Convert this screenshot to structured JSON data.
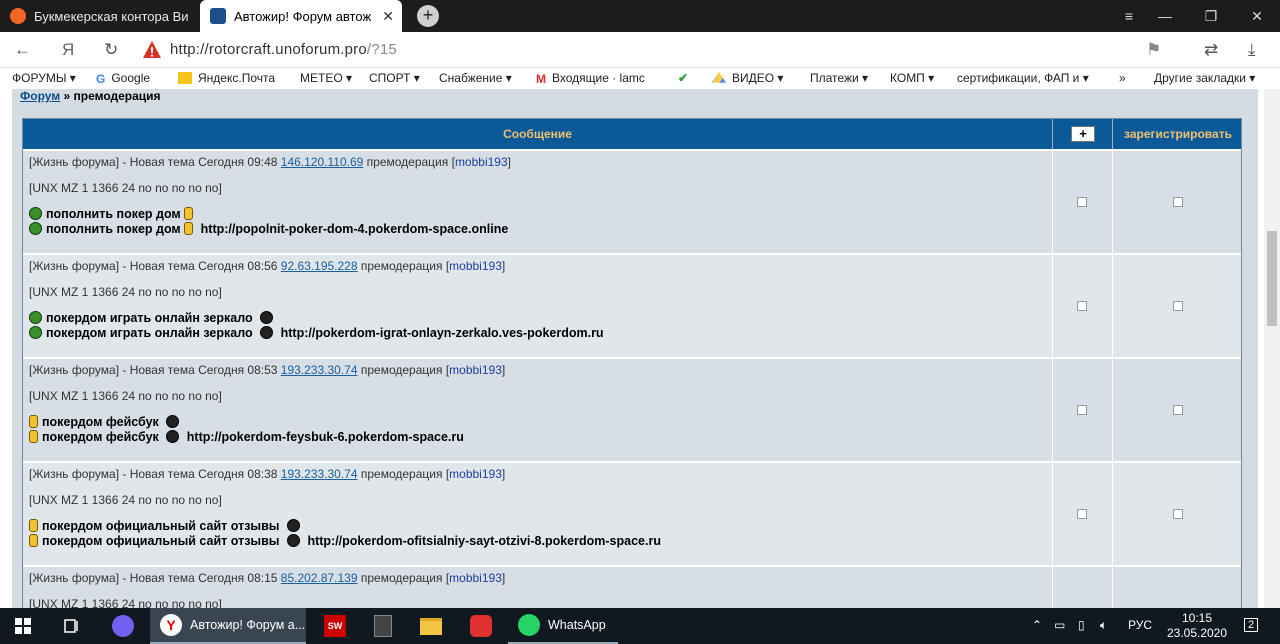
{
  "browser": {
    "tabs": [
      {
        "title": "Букмекерская контора Ви",
        "active": false,
        "favicon_color": "#f26522"
      },
      {
        "title": "Автожир! Форум автож",
        "active": true,
        "favicon_color": "#1e4f8a"
      }
    ],
    "new_tab_symbol": "+",
    "window_controls": {
      "menu": "≡",
      "minimize": "—",
      "restore": "❐",
      "close": "✕"
    },
    "address": {
      "domain": "http://rotorcraft.unoforum.pro",
      "path": "/?15"
    },
    "nav": {
      "back": "←",
      "yandex": "Я",
      "reload": "↻"
    },
    "right_icons": {
      "bookmark": "⚑",
      "share": "⇄",
      "download": "⤓"
    },
    "bookmarks": [
      {
        "label": "ФОРУМЫ ▾"
      },
      {
        "label": "Google"
      },
      {
        "label": "Яндекс.Почта"
      },
      {
        "label": "МЕТЕО ▾"
      },
      {
        "label": "СПОРТ ▾"
      },
      {
        "label": "Снабжение ▾"
      },
      {
        "label": "Входящие · lamc"
      },
      {
        "label": ""
      },
      {
        "label": "ВИДЕО ▾"
      },
      {
        "label": "Платежи ▾"
      },
      {
        "label": "КОМП ▾"
      },
      {
        "label": "сертификации, ФАП и ▾"
      },
      {
        "label": "»"
      },
      {
        "label": "Другие закладки ▾"
      }
    ]
  },
  "page": {
    "breadcrumb": {
      "forum_link": "Форум",
      "separator": "»",
      "current": "премодерация"
    },
    "table": {
      "header_message": "Сообщение",
      "header_plus": "+",
      "header_register": "зарегистрировать",
      "rows": [
        {
          "prefix": "[Жизнь форума] - Новая тема Сегодня 09:48",
          "ip": "146.120.110.69",
          "status": "премодерация [",
          "user": "mobbi193",
          "close": "]",
          "ua": "[UNX MZ 1 1366 24 no no no no no]",
          "line_a": "пополнить покер дом",
          "line_b": "пополнить покер дом",
          "url": "http://popolnit-poker-dom-4.pokerdom-space.online",
          "icons": [
            "green",
            "yellow"
          ]
        },
        {
          "prefix": "[Жизнь форума] - Новая тема Сегодня 08:56",
          "ip": "92.63.195.228",
          "status": "премодерация [",
          "user": "mobbi193",
          "close": "]",
          "ua": "[UNX MZ 1 1366 24 no no no no no]",
          "line_a": "покердом играть онлайн зеркало",
          "line_b": "покердом играть онлайн зеркало",
          "url": "http://pokerdom-igrat-onlayn-zerkalo.ves-pokerdom.ru",
          "icons": [
            "green",
            "bomb"
          ]
        },
        {
          "prefix": "[Жизнь форума] - Новая тема Сегодня 08:53",
          "ip": "193.233.30.74",
          "status": "премодерация [",
          "user": "mobbi193",
          "close": "]",
          "ua": "[UNX MZ 1 1366 24 no no no no no]",
          "line_a": "покердом фейсбук",
          "line_b": "покердом фейсбук",
          "url": "http://pokerdom-feysbuk-6.pokerdom-space.ru",
          "icons": [
            "yellow",
            "bomb"
          ]
        },
        {
          "prefix": "[Жизнь форума] - Новая тема Сегодня 08:38",
          "ip": "193.233.30.74",
          "status": "премодерация [",
          "user": "mobbi193",
          "close": "]",
          "ua": "[UNX MZ 1 1366 24 no no no no no]",
          "line_a": "покердом официальный сайт отзывы",
          "line_b": "покердом официальный сайт отзывы",
          "url": "http://pokerdom-ofitsialniy-sayt-otzivi-8.pokerdom-space.ru",
          "icons": [
            "yellow",
            "bomb"
          ]
        },
        {
          "prefix": "[Жизнь форума] - Новая тема Сегодня 08:15",
          "ip": "85.202.87.139",
          "status": "премодерация [",
          "user": "mobbi193",
          "close": "]",
          "ua": "[UNX MZ 1 1366 24 no no no no no]",
          "line_a": "",
          "line_b": "",
          "url": "",
          "icons": []
        }
      ]
    }
  },
  "taskbar": {
    "items": [
      {
        "name": "start",
        "label": ""
      },
      {
        "name": "task-view",
        "label": ""
      },
      {
        "name": "viber",
        "label": ""
      },
      {
        "name": "yandex-browser",
        "label": "Автожир! Форум а..."
      },
      {
        "name": "sw2016",
        "label": ""
      },
      {
        "name": "calculator",
        "label": ""
      },
      {
        "name": "explorer",
        "label": ""
      },
      {
        "name": "red-app",
        "label": ""
      },
      {
        "name": "whatsapp",
        "label": "WhatsApp"
      }
    ],
    "tray_lang": "РУС",
    "time": "10:15",
    "date": "23.05.2020",
    "notifications": "2"
  }
}
